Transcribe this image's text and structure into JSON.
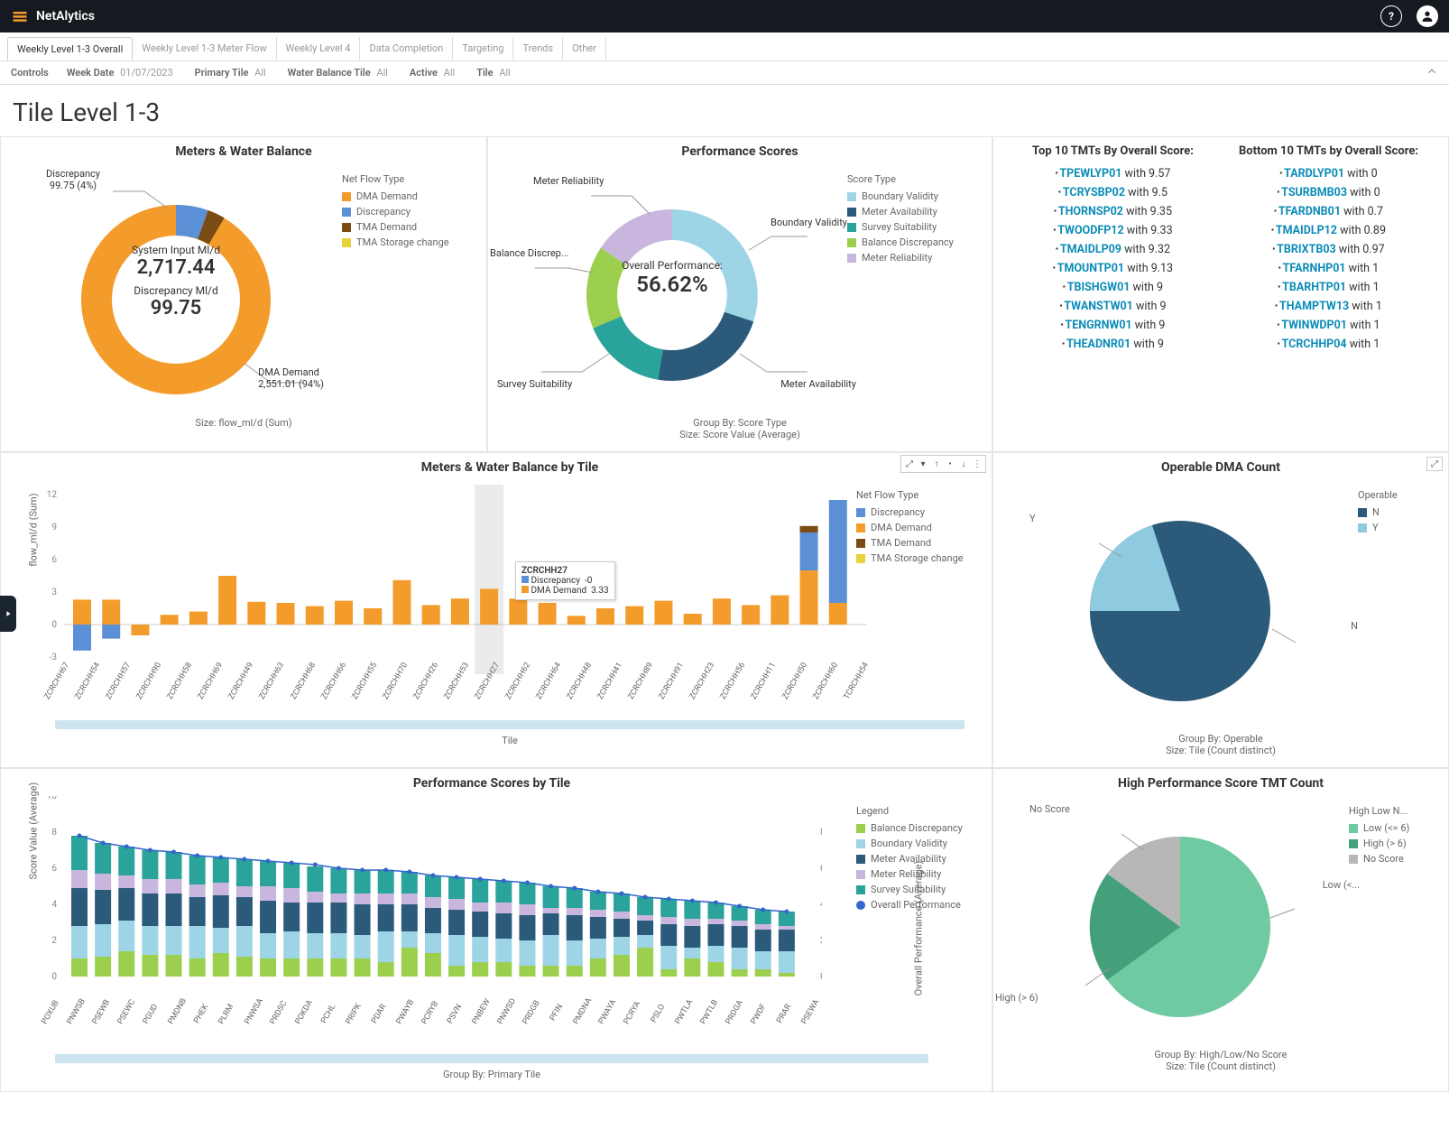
{
  "header": {
    "brand": "NetAlytics"
  },
  "tabs": [
    "Weekly Level 1-3 Overall",
    "Weekly Level 1-3 Meter Flow",
    "Weekly Level 4",
    "Data Completion",
    "Targeting",
    "Trends",
    "Other"
  ],
  "activeTab": 0,
  "controls": {
    "title": "Controls",
    "items": [
      {
        "label": "Week Date",
        "value": "01/07/2023"
      },
      {
        "label": "Primary Tile",
        "value": "All"
      },
      {
        "label": "Water Balance Tile",
        "value": "All"
      },
      {
        "label": "Active",
        "value": "All"
      },
      {
        "label": "Tile",
        "value": "All"
      }
    ]
  },
  "page_title": "Tile Level 1-3",
  "panel_meters": {
    "title": "Meters & Water Balance",
    "legend_title": "Net Flow Type",
    "legend": [
      {
        "label": "DMA Demand",
        "color": "#f39c2b"
      },
      {
        "label": "Discrepancy",
        "color": "#5b8fd6"
      },
      {
        "label": "TMA Demand",
        "color": "#7a4b13"
      },
      {
        "label": "TMA Storage change",
        "color": "#e6d23b"
      }
    ],
    "center": {
      "l1": "System Input Ml/d",
      "v1": "2,717.44",
      "l2": "Discrepancy Ml/d",
      "v2": "99.75"
    },
    "callout_top": {
      "label": "Discrepancy",
      "value": "99.75 (4%)"
    },
    "callout_bottom": {
      "label": "DMA Demand",
      "value": "2,551.01 (94%)"
    },
    "footer": "Size: flow_ml/d (Sum)"
  },
  "panel_perf": {
    "title": "Performance Scores",
    "legend_title": "Score Type",
    "legend": [
      {
        "label": "Boundary Validity",
        "color": "#9ed5e6"
      },
      {
        "label": "Meter Availability",
        "color": "#2b5a7a"
      },
      {
        "label": "Survey Suitability",
        "color": "#2aa39a"
      },
      {
        "label": "Balance Discrepancy",
        "color": "#9bcf4d"
      },
      {
        "label": "Meter Reliability",
        "color": "#c9b6df"
      }
    ],
    "center": {
      "l": "Overall Performance:",
      "v": "56.62%"
    },
    "spokes": [
      "Meter Reliability",
      "Boundary Validity",
      "Meter Availability",
      "Survey Suitability",
      "Balance Discrep..."
    ],
    "footer1": "Group By: Score Type",
    "footer2": "Size: Score Value (Average)"
  },
  "tmt": {
    "top_title": "Top 10 TMTs By Overall Score:",
    "bottom_title": "Bottom 10 TMTs by Overall Score:",
    "top": [
      {
        "id": "TPEWLYP01",
        "score": "9.57"
      },
      {
        "id": "TCRYSBP02",
        "score": "9.5"
      },
      {
        "id": "THORNSP02",
        "score": "9.35"
      },
      {
        "id": "TWOODFP12",
        "score": "9.33"
      },
      {
        "id": "TMAIDLP09",
        "score": "9.32"
      },
      {
        "id": "TMOUNTP01",
        "score": "9.13"
      },
      {
        "id": "TBISHGW01",
        "score": "9"
      },
      {
        "id": "TWANSTW01",
        "score": "9"
      },
      {
        "id": "TENGRNW01",
        "score": "9"
      },
      {
        "id": "THEADNR01",
        "score": "9"
      }
    ],
    "bottom": [
      {
        "id": "TARDLYP01",
        "score": "0"
      },
      {
        "id": "TSURBMB03",
        "score": "0"
      },
      {
        "id": "TFARDNB01",
        "score": "0.7"
      },
      {
        "id": "TMAIDLP12",
        "score": "0.89"
      },
      {
        "id": "TBRIXTB03",
        "score": "0.97"
      },
      {
        "id": "TFARNHP01",
        "score": "1"
      },
      {
        "id": "TBARHTP01",
        "score": "1"
      },
      {
        "id": "THAMPTW13",
        "score": "1"
      },
      {
        "id": "TWINWDP01",
        "score": "1"
      },
      {
        "id": "TCRCHHP04",
        "score": "1"
      }
    ]
  },
  "panel_mwb_tile": {
    "title": "Meters & Water Balance by Tile",
    "legend_title": "Net Flow Type",
    "legend": [
      {
        "label": "Discrepancy",
        "color": "#5b8fd6"
      },
      {
        "label": "DMA Demand",
        "color": "#f39c2b"
      },
      {
        "label": "TMA Demand",
        "color": "#7a4b13"
      },
      {
        "label": "TMA Storage change",
        "color": "#e6d23b"
      }
    ],
    "ylabel": "flow_ml/d (Sum)",
    "xlabel": "Tile",
    "tooltip": {
      "tile": "ZCRCHH27",
      "l1": "Discrepancy",
      "v1": "-0",
      "l2": "DMA Demand",
      "v2": "3.33"
    }
  },
  "panel_operable": {
    "title": "Operable DMA Count",
    "legend_title": "Operable",
    "legend": [
      {
        "label": "N",
        "color": "#2b5a7a"
      },
      {
        "label": "Y",
        "color": "#8fcbe0"
      }
    ],
    "footer1": "Group By: Operable",
    "footer2": "Size: Tile (Count distinct)",
    "slice_labels": {
      "y": "Y",
      "n": "N"
    }
  },
  "panel_perf_tile": {
    "title": "Performance Scores by Tile",
    "legend_title": "Legend",
    "legend": [
      {
        "label": "Balance Discrepancy",
        "color": "#9bcf4d"
      },
      {
        "label": "Boundary Validity",
        "color": "#9ed5e6"
      },
      {
        "label": "Meter Availability",
        "color": "#2b5a7a"
      },
      {
        "label": "Meter Reliability",
        "color": "#c9b6df"
      },
      {
        "label": "Survey Suitability",
        "color": "#2aa39a"
      },
      {
        "label": "Overall Performance",
        "color": "#3366cc"
      }
    ],
    "ylabel": "Score Value (Average)",
    "ylabel2": "Overall Performance (Average)",
    "xlabel": "Group By: Primary Tile"
  },
  "panel_hilo": {
    "title": "High Performance Score TMT Count",
    "legend_title": "High Low N...",
    "legend": [
      {
        "label": "Low (<= 6)",
        "color": "#6fc9a1"
      },
      {
        "label": "High (> 6)",
        "color": "#43a07a"
      },
      {
        "label": "No Score",
        "color": "#b7b7b7"
      }
    ],
    "slice_labels": {
      "no": "No Score",
      "hi": "High (> 6)",
      "lo": "Low  (<..."
    },
    "footer1": "Group By: High/Low/No Score",
    "footer2": "Size: Tile (Count distinct)"
  },
  "chart_data": [
    {
      "id": "meters_water_balance_donut",
      "type": "pie",
      "title": "Meters & Water Balance",
      "series": [
        {
          "name": "DMA Demand",
          "value": 2551.01,
          "pct": 94
        },
        {
          "name": "Discrepancy",
          "value": 99.75,
          "pct": 4
        },
        {
          "name": "TMA Demand",
          "value": 33,
          "pct": 1
        },
        {
          "name": "TMA Storage change",
          "value": 33,
          "pct": 1
        }
      ],
      "center_values": {
        "System Input Ml/d": 2717.44,
        "Discrepancy Ml/d": 99.75
      }
    },
    {
      "id": "performance_scores_donut",
      "type": "pie",
      "title": "Performance Scores",
      "series": [
        {
          "name": "Boundary Validity",
          "value": 24
        },
        {
          "name": "Meter Availability",
          "value": 22
        },
        {
          "name": "Survey Suitability",
          "value": 20
        },
        {
          "name": "Balance Discrepancy",
          "value": 18
        },
        {
          "name": "Meter Reliability",
          "value": 16
        }
      ],
      "center_values": {
        "Overall Performance %": 56.62
      }
    },
    {
      "id": "meters_water_balance_by_tile",
      "type": "bar",
      "title": "Meters & Water Balance by Tile",
      "ylabel": "flow_ml/d (Sum)",
      "xlabel": "Tile",
      "ylim": [
        -3,
        12
      ],
      "categories": [
        "ZCRCHH67",
        "ZCRCHH54",
        "ZCRCHH57",
        "ZCRCHH90",
        "ZCRCHH58",
        "ZCRCHH69",
        "ZCRCHH49",
        "ZCRCHH63",
        "ZCRCHH68",
        "ZCRCHH66",
        "ZCRCHH55",
        "ZCRCHH70",
        "ZCRCHH26",
        "ZCRCHH53",
        "ZCRCHH27",
        "ZCRCHH62",
        "ZCRCHH64",
        "ZCRCHH48",
        "ZCRCHH41",
        "ZCRCHH89",
        "ZCRCHH91",
        "ZCRCHH23",
        "ZCRCHH56",
        "ZCRCHH11",
        "ZCRCHH50",
        "ZCRCHH60",
        "TCRCHH54"
      ],
      "series": [
        {
          "name": "DMA Demand",
          "values": [
            2.3,
            2.3,
            -1.0,
            0.9,
            1.2,
            4.5,
            2.1,
            2.0,
            1.7,
            2.2,
            1.5,
            4.1,
            1.8,
            2.4,
            3.3,
            2.4,
            2.0,
            0.8,
            1.5,
            1.7,
            2.2,
            1.0,
            2.4,
            1.8,
            2.7,
            5.0,
            2.0
          ]
        },
        {
          "name": "Discrepancy",
          "values": [
            -2.4,
            -1.3,
            0,
            0,
            0,
            0,
            0,
            0,
            0,
            0,
            0,
            0,
            0,
            0,
            0,
            0,
            0,
            0,
            0,
            0,
            0,
            0,
            0,
            0,
            0,
            3.5,
            9.5
          ]
        },
        {
          "name": "TMA Demand",
          "values": [
            0,
            0,
            0,
            0,
            0,
            0,
            0,
            0,
            0,
            0,
            0,
            0,
            0,
            0,
            0,
            0,
            0,
            0,
            0,
            0,
            0,
            0,
            0,
            0,
            0,
            0.6,
            0
          ]
        },
        {
          "name": "TMA Storage change",
          "values": [
            0,
            0,
            0,
            0,
            0,
            0,
            0,
            0,
            0,
            0,
            0,
            0,
            0,
            0,
            0,
            0,
            0,
            0,
            0,
            0,
            0,
            0,
            0,
            0,
            0,
            0,
            0
          ]
        }
      ]
    },
    {
      "id": "operable_dma_count",
      "type": "pie",
      "title": "Operable DMA Count",
      "series": [
        {
          "name": "N",
          "value": 72
        },
        {
          "name": "Y",
          "value": 28
        }
      ]
    },
    {
      "id": "performance_scores_by_tile",
      "type": "bar",
      "title": "Performance Scores by Tile",
      "ylabel": "Score Value (Average)",
      "xlabel": "Primary Tile",
      "ylim": [
        0,
        10
      ],
      "ylim2": [
        0,
        100
      ],
      "categories": [
        "POXUB",
        "PNWSB",
        "PSEWB",
        "PSEWC",
        "PGUD",
        "PMDNB",
        "PHEK",
        "PLRM",
        "PNWSA",
        "PRDSC",
        "POKDA",
        "PCHL",
        "PRIPK",
        "PDAR",
        "PWAYB",
        "PCRYB",
        "PSVN",
        "PNBEW",
        "PNWSD",
        "PRDGB",
        "PFIN",
        "PMDNA",
        "PWAYA",
        "PCRYA",
        "PSLO",
        "PWTLA",
        "PWTLB",
        "PRDGA",
        "PWDF",
        "PRAR",
        "PSEWA"
      ],
      "series": [
        {
          "name": "Balance Discrepancy",
          "values": [
            1.0,
            1.1,
            1.4,
            1.2,
            1.2,
            1.0,
            1.3,
            1.1,
            1.0,
            1.0,
            1.0,
            1.0,
            1.0,
            0.8,
            1.6,
            1.3,
            0.6,
            0.8,
            0.8,
            0.6,
            0.6,
            0.6,
            1.0,
            1.2,
            1.6,
            0.4,
            1.0,
            0.8,
            0.4,
            0.4,
            0.2
          ]
        },
        {
          "name": "Boundary Validity",
          "values": [
            1.8,
            1.8,
            1.7,
            1.6,
            1.6,
            1.8,
            1.4,
            1.7,
            1.4,
            1.5,
            1.4,
            1.4,
            1.3,
            1.7,
            0.9,
            1.1,
            1.7,
            1.4,
            1.3,
            1.4,
            1.7,
            1.4,
            1.1,
            1.0,
            0.7,
            1.3,
            0.6,
            0.9,
            1.2,
            1.0,
            1.2
          ]
        },
        {
          "name": "Meter Availability",
          "values": [
            2.1,
            1.9,
            1.8,
            1.8,
            1.8,
            1.6,
            1.8,
            1.6,
            1.8,
            1.6,
            1.7,
            1.7,
            1.7,
            1.5,
            1.5,
            1.4,
            1.4,
            1.4,
            1.4,
            1.4,
            1.2,
            1.4,
            1.2,
            1.0,
            0.8,
            1.2,
            1.2,
            1.2,
            1.2,
            1.2,
            1.2
          ]
        },
        {
          "name": "Meter Reliability",
          "values": [
            1.0,
            0.9,
            0.7,
            0.8,
            0.8,
            0.7,
            0.7,
            0.6,
            0.8,
            0.8,
            0.6,
            0.5,
            0.6,
            0.6,
            0.6,
            0.6,
            0.6,
            0.5,
            0.6,
            0.6,
            0.3,
            0.4,
            0.4,
            0.4,
            0.3,
            0.4,
            0.4,
            0.3,
            0.3,
            0.3,
            0.2
          ]
        },
        {
          "name": "Survey Suitability",
          "values": [
            1.9,
            1.7,
            1.6,
            1.6,
            1.5,
            1.6,
            1.4,
            1.5,
            1.4,
            1.4,
            1.4,
            1.4,
            1.3,
            1.3,
            1.2,
            1.2,
            1.2,
            1.3,
            1.2,
            1.2,
            1.2,
            1.1,
            1.0,
            1.0,
            1.0,
            1.0,
            1.0,
            0.9,
            0.8,
            0.8,
            0.8
          ]
        }
      ],
      "overall_line": [
        78,
        74,
        72,
        70,
        69,
        67,
        66,
        65,
        64,
        63,
        62,
        60,
        59,
        59,
        58,
        56,
        55,
        54,
        53,
        52,
        50,
        49,
        47,
        46,
        44,
        43,
        42,
        41,
        39,
        37,
        36
      ]
    },
    {
      "id": "high_low_tmt_count",
      "type": "pie",
      "title": "High Performance Score TMT Count",
      "series": [
        {
          "name": "Low (<= 6)",
          "value": 65
        },
        {
          "name": "High (> 6)",
          "value": 20
        },
        {
          "name": "No Score",
          "value": 15
        }
      ]
    }
  ]
}
